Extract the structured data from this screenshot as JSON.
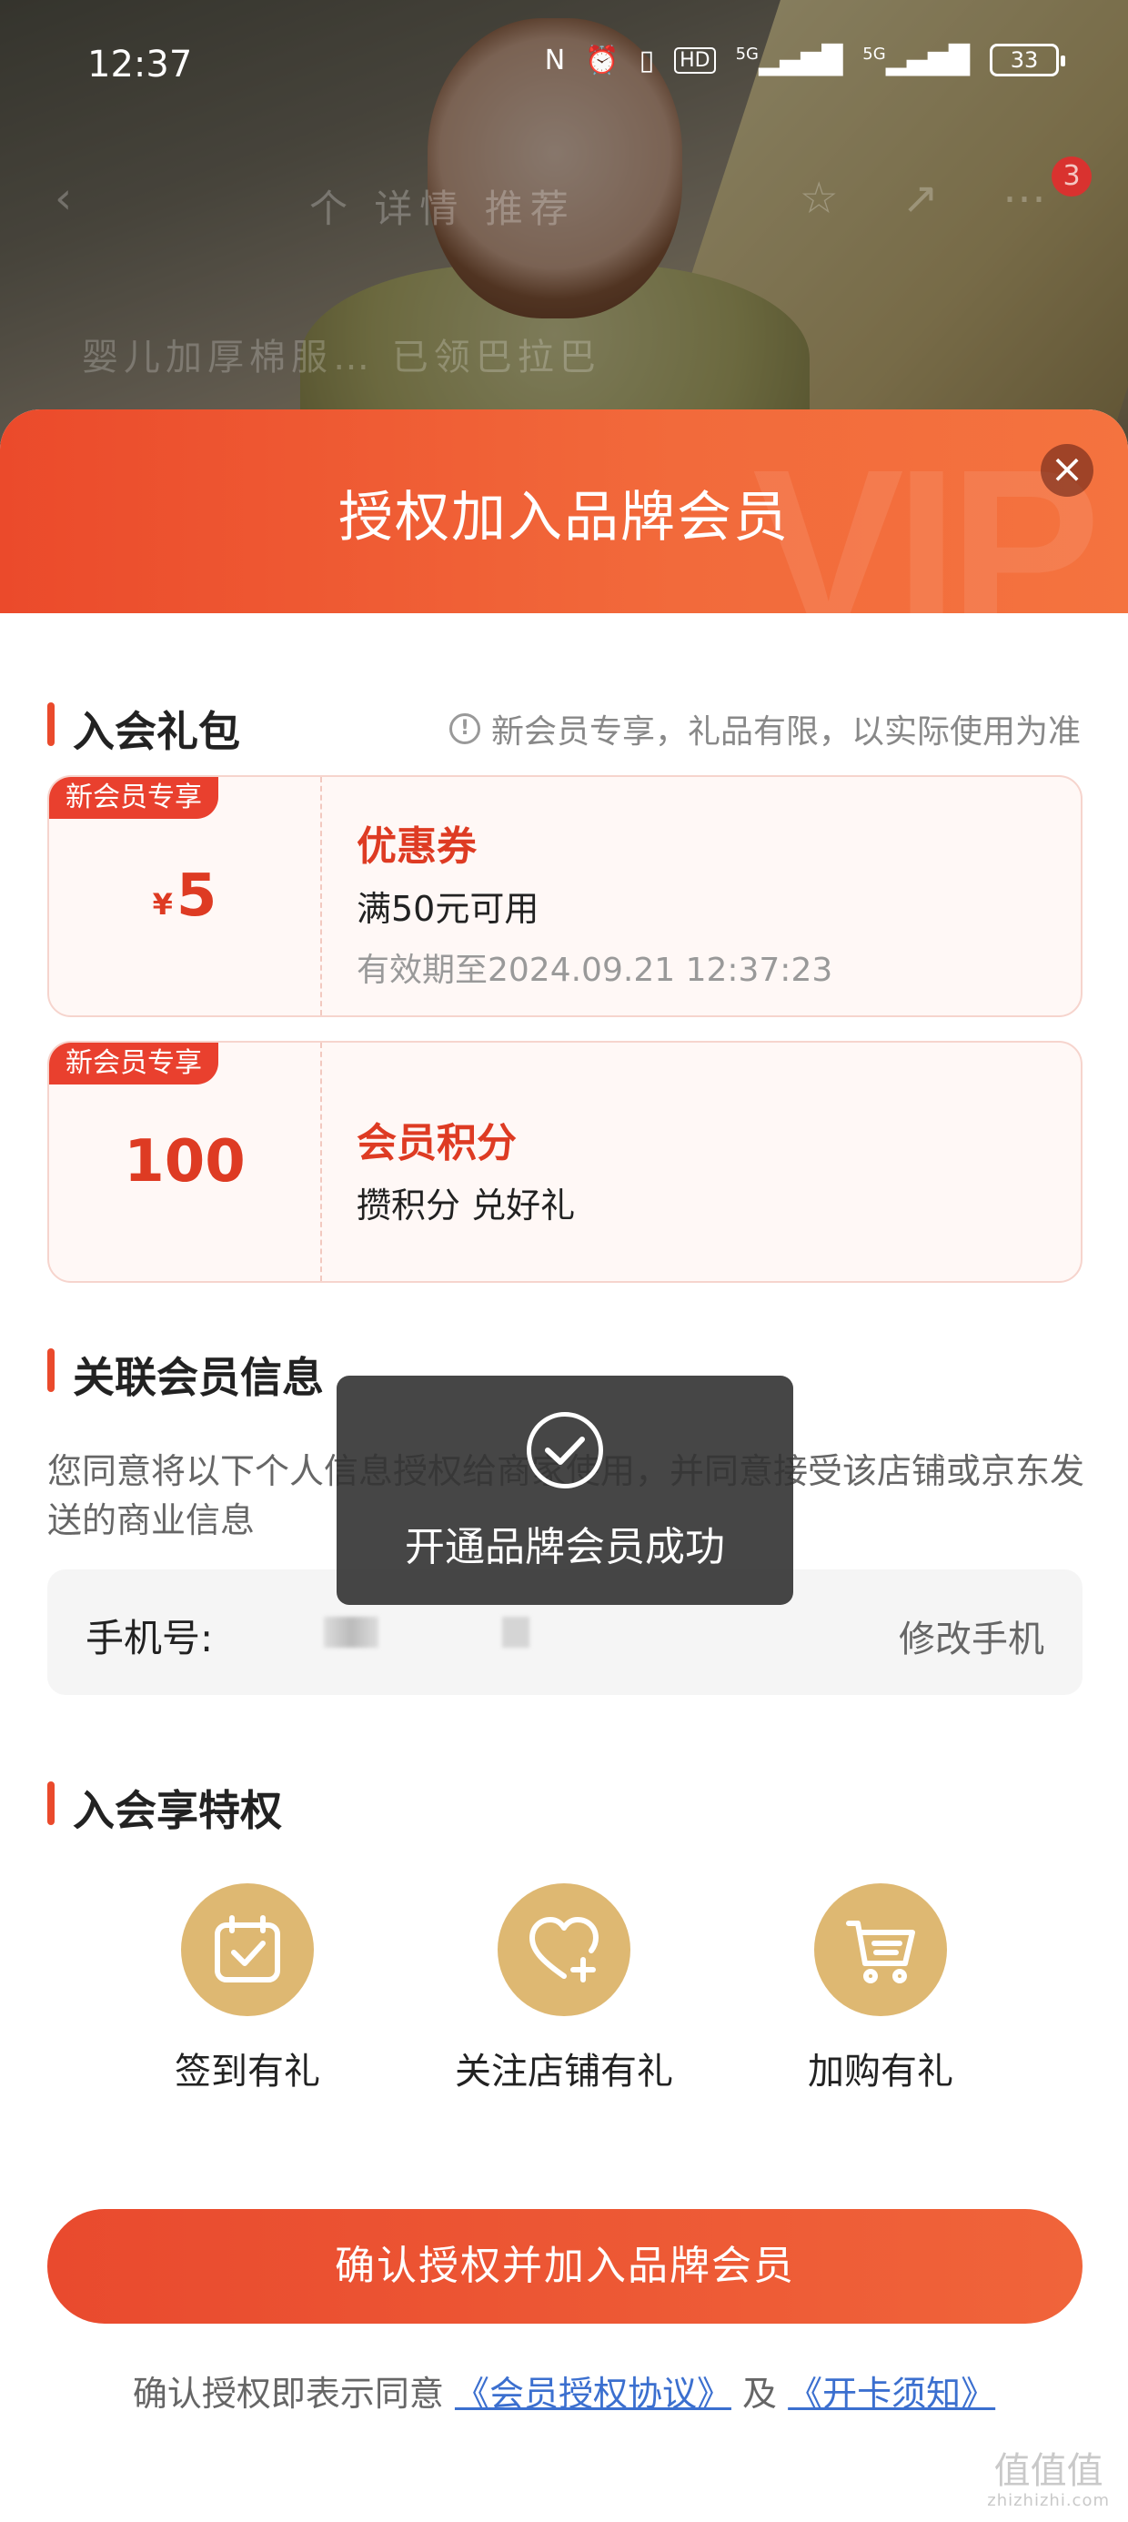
{
  "status_bar": {
    "time": "12:37",
    "icons": [
      "nfc-icon",
      "alarm-icon",
      "vibrate-icon",
      "hd-icon",
      "signal-5g-icon",
      "signal-5g-icon"
    ],
    "hd_label": "HD",
    "net1": "5G",
    "net2": "5G",
    "battery": "33"
  },
  "background_page": {
    "nav_tabs": "个  详情  推荐",
    "badge_count": "3",
    "sub_text": "婴儿加厚棉服…  已领巴拉巴"
  },
  "sheet": {
    "title": "授权加入品牌会员",
    "watermark": "VIP",
    "close_label": "×"
  },
  "gift_section": {
    "title": "入会礼包",
    "note": "新会员专享，礼品有限，以实际使用为准",
    "items": [
      {
        "tag": "新会员专享",
        "currency": "¥",
        "amount": "5",
        "name": "优惠券",
        "desc": "满50元可用",
        "expiry": "有效期至2024.09.21 12:37:23"
      },
      {
        "tag": "新会员专享",
        "currency": "",
        "amount": "100",
        "name": "会员积分",
        "desc": "攒积分 兑好礼",
        "expiry": ""
      }
    ]
  },
  "member_info": {
    "title": "关联会员信息",
    "consent": "您同意将以下个人信息授权给商家使用，并同意接受该店铺或京东发送的商业信息",
    "phone_label": "手机号:",
    "edit_label": "修改手机"
  },
  "perks_section": {
    "title": "入会享特权",
    "items": [
      {
        "label": "签到有礼",
        "icon": "calendar-check-icon"
      },
      {
        "label": "关注店铺有礼",
        "icon": "heart-plus-icon"
      },
      {
        "label": "加购有礼",
        "icon": "shopping-cart-icon"
      }
    ]
  },
  "actions": {
    "confirm_label": "确认授权并加入品牌会员",
    "agree_prefix": "确认授权即表示同意",
    "agreement_link": "《会员授权协议》",
    "agree_and": "及",
    "card_link": "《开卡须知》"
  },
  "toast": {
    "message": "开通品牌会员成功",
    "icon": "check-circle-icon"
  },
  "watermark_logo": {
    "mark": "值值值",
    "url": "zhizhizhi.com"
  },
  "colors": {
    "accent": "#e94a2e",
    "gold": "#deb872",
    "link": "#3b6fcf"
  }
}
